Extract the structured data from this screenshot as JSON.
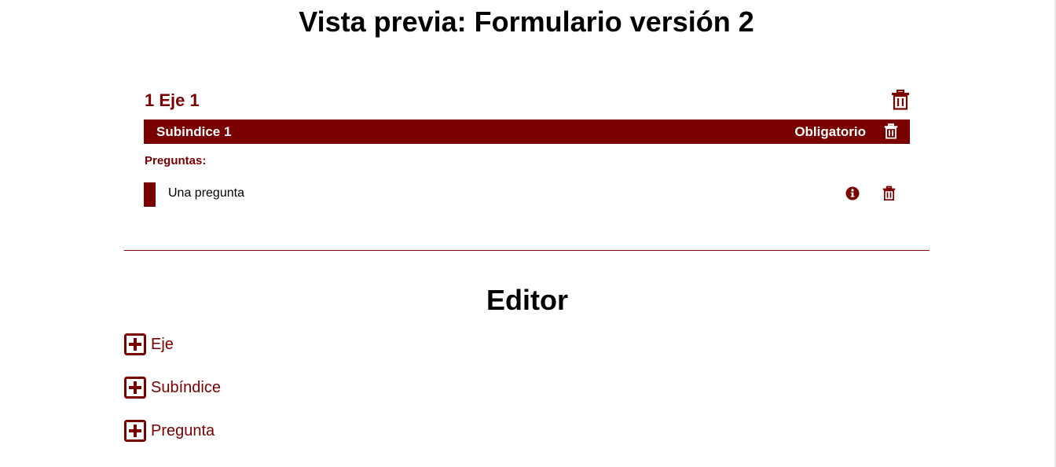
{
  "page": {
    "title": "Vista previa: Formulario versión 2"
  },
  "preview": {
    "eje": {
      "title": "1 Eje 1",
      "delete_icon": "trash-icon"
    },
    "subindice": {
      "title": "Subindice 1",
      "status": "Obligatorio",
      "delete_icon": "trash-icon"
    },
    "preguntas_label": "Preguntas:",
    "questions": [
      {
        "text": "Una pregunta",
        "info_icon": "info-circle-icon",
        "delete_icon": "trash-icon"
      }
    ]
  },
  "editor": {
    "title": "Editor",
    "actions": [
      {
        "label": "Eje",
        "icon": "plus-square-icon"
      },
      {
        "label": "Subíndice",
        "icon": "plus-square-icon"
      },
      {
        "label": "Pregunta",
        "icon": "plus-square-icon"
      }
    ]
  },
  "colors": {
    "accent": "#7a0000",
    "text": "#000000",
    "background": "#ffffff"
  }
}
